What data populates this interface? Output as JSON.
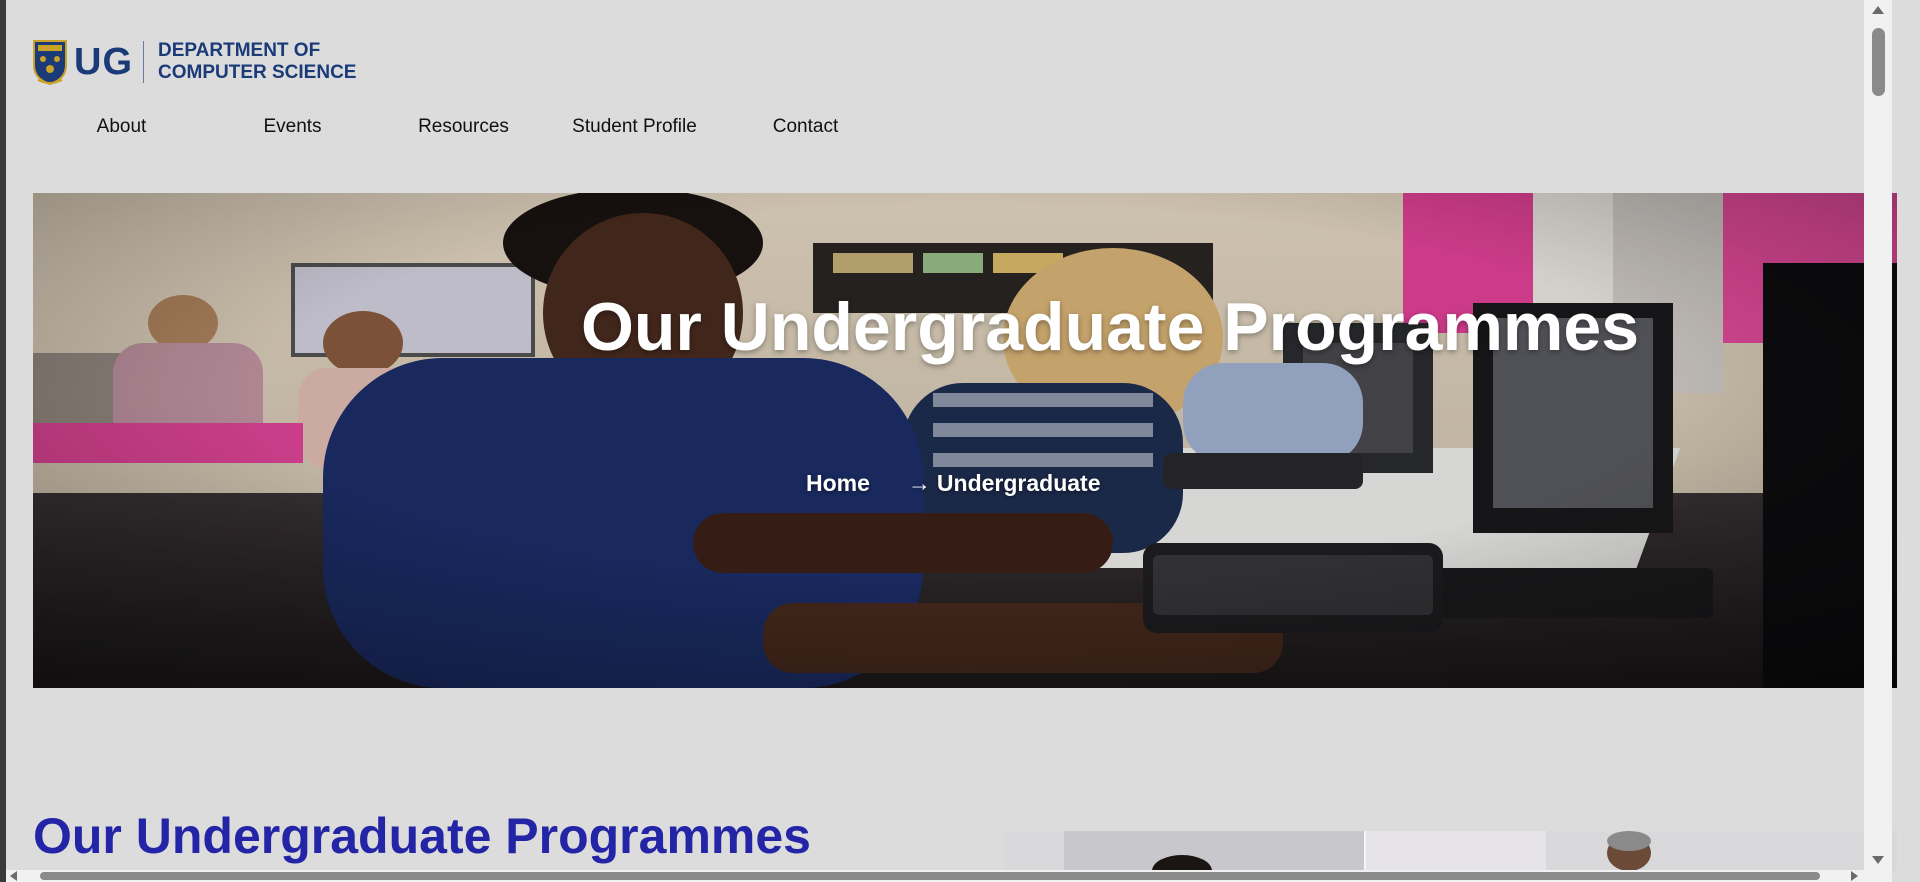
{
  "brand": {
    "ug": "UG",
    "dept_line1": "DEPARTMENT OF",
    "dept_line2": "COMPUTER SCIENCE",
    "color": "#1a3a78"
  },
  "nav": {
    "items": [
      {
        "label": "About"
      },
      {
        "label": "Events"
      },
      {
        "label": "Resources"
      },
      {
        "label": "Student Profile"
      },
      {
        "label": "Contact"
      }
    ]
  },
  "hero": {
    "title": "Our Undergraduate Programmes",
    "breadcrumb": {
      "home": "Home",
      "separator": "→",
      "current": "Undergraduate"
    }
  },
  "main": {
    "section_title": "Our Undergraduate Programmes",
    "title_color": "#2324a6"
  }
}
